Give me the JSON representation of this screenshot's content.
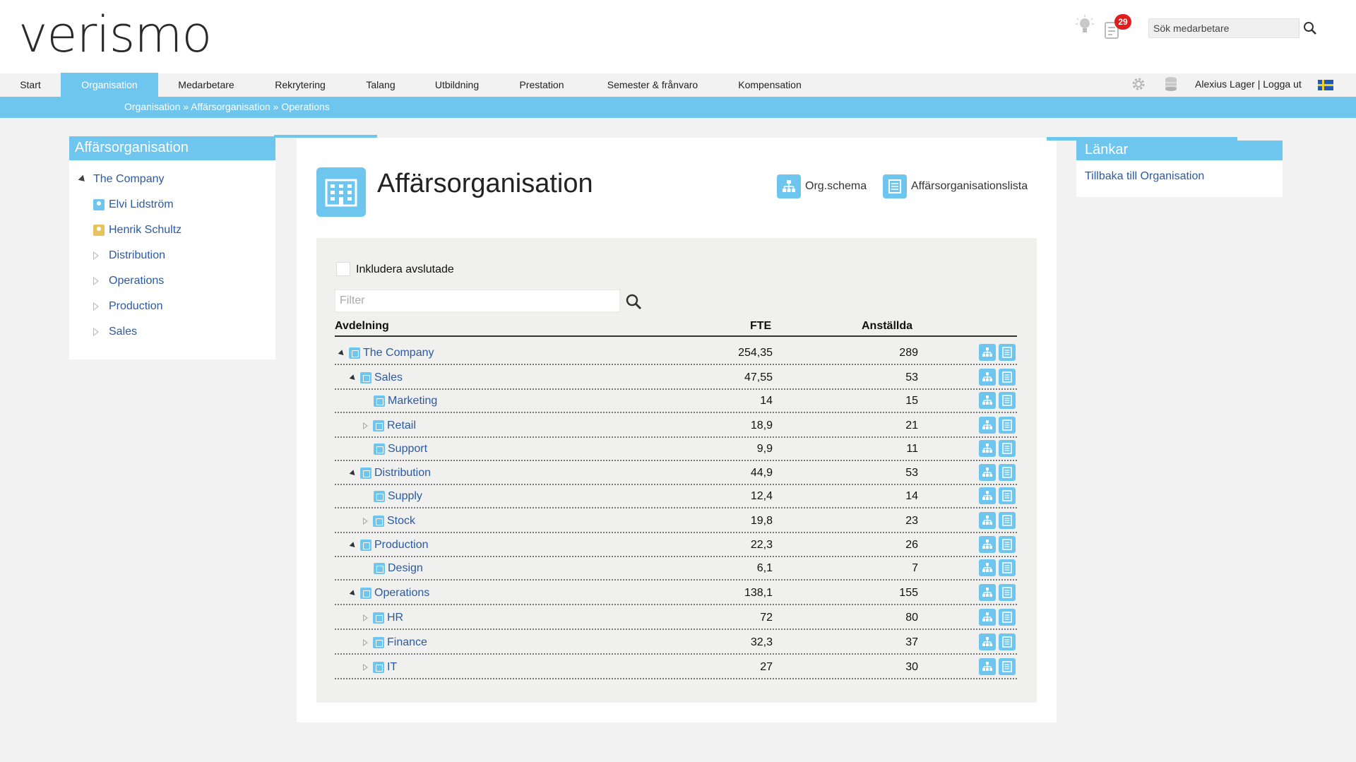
{
  "app": {
    "logo": "verismo",
    "notification_count": "29",
    "search_placeholder": "Sök medarbetare",
    "user_name": "Alexius Lager",
    "logout": "Logga ut",
    "separator": "|"
  },
  "nav": {
    "items": [
      {
        "label": "Start",
        "active": false
      },
      {
        "label": "Organisation",
        "active": true
      },
      {
        "label": "Medarbetare",
        "active": false
      },
      {
        "label": "Rekrytering",
        "active": false
      },
      {
        "label": "Talang",
        "active": false
      },
      {
        "label": "Utbildning",
        "active": false
      },
      {
        "label": "Prestation",
        "active": false
      },
      {
        "label": "Semester & frånvaro",
        "active": false
      },
      {
        "label": "Kompensation",
        "active": false
      }
    ]
  },
  "breadcrumb": "Organisation » Affärsorganisation » Operations",
  "left_panel": {
    "title": "Affärsorganisation",
    "tree": [
      {
        "label": "The Company",
        "type": "expanded"
      },
      {
        "label": "Elvi Lidström",
        "type": "person",
        "color": "#6ec6ef"
      },
      {
        "label": "Henrik Schultz",
        "type": "person",
        "color": "#e6c35c"
      },
      {
        "label": "Distribution",
        "type": "collapsed"
      },
      {
        "label": "Operations",
        "type": "collapsed"
      },
      {
        "label": "Production",
        "type": "collapsed"
      },
      {
        "label": "Sales",
        "type": "collapsed"
      }
    ]
  },
  "main": {
    "title": "Affärsorganisation",
    "org_chart_link": "Org.schema",
    "list_link": "Affärsorganisationslista",
    "include_ended_label": "Inkludera avslutade",
    "filter_placeholder": "Filter",
    "columns": {
      "dept": "Avdelning",
      "fte": "FTE",
      "employees": "Anställda"
    },
    "rows": [
      {
        "name": "The Company",
        "level": 0,
        "toggle": "open",
        "fte": "254,35",
        "employees": "289"
      },
      {
        "name": "Sales",
        "level": 1,
        "toggle": "open",
        "fte": "47,55",
        "employees": "53"
      },
      {
        "name": "Marketing",
        "level": 2,
        "toggle": "none",
        "fte": "14",
        "employees": "15"
      },
      {
        "name": "Retail",
        "level": 2,
        "toggle": "closed",
        "fte": "18,9",
        "employees": "21"
      },
      {
        "name": "Support",
        "level": 2,
        "toggle": "none",
        "fte": "9,9",
        "employees": "11"
      },
      {
        "name": "Distribution",
        "level": 1,
        "toggle": "open",
        "fte": "44,9",
        "employees": "53"
      },
      {
        "name": "Supply",
        "level": 2,
        "toggle": "none",
        "fte": "12,4",
        "employees": "14"
      },
      {
        "name": "Stock",
        "level": 2,
        "toggle": "closed",
        "fte": "19,8",
        "employees": "23"
      },
      {
        "name": "Production",
        "level": 1,
        "toggle": "open",
        "fte": "22,3",
        "employees": "26"
      },
      {
        "name": "Design",
        "level": 2,
        "toggle": "none",
        "fte": "6,1",
        "employees": "7"
      },
      {
        "name": "Operations",
        "level": 1,
        "toggle": "open",
        "fte": "138,1",
        "employees": "155"
      },
      {
        "name": "HR",
        "level": 2,
        "toggle": "closed",
        "fte": "72",
        "employees": "80"
      },
      {
        "name": "Finance",
        "level": 2,
        "toggle": "closed",
        "fte": "32,3",
        "employees": "37"
      },
      {
        "name": "IT",
        "level": 2,
        "toggle": "closed",
        "fte": "27",
        "employees": "30"
      }
    ]
  },
  "right_panel": {
    "title": "Länkar",
    "link": "Tillbaka till Organisation"
  },
  "colors": {
    "accent": "#6ec6ef",
    "link": "#2c5aa0",
    "badge": "#e01e1e"
  }
}
